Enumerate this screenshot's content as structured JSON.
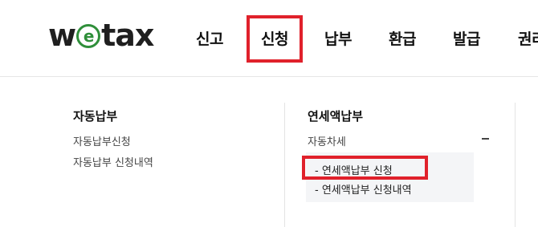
{
  "logo": {
    "part1": "w",
    "part_e": "e",
    "part2": "tax"
  },
  "nav": [
    {
      "label": "신고"
    },
    {
      "label": "신청"
    },
    {
      "label": "납부"
    },
    {
      "label": "환급"
    },
    {
      "label": "발급"
    },
    {
      "label": "권리"
    }
  ],
  "menu": {
    "col1": {
      "title": "자동납부",
      "links": [
        "자동납부신청",
        "자동납부 신청내역"
      ]
    },
    "col2": {
      "title": "연세액납부",
      "group_label": "자동차세",
      "group_icon": "minus-icon",
      "sub_links": [
        "- 연세액납부 신청",
        "- 연세액납부 신청내역"
      ]
    }
  },
  "colors": {
    "highlight": "#e0212b",
    "logo_green": "#2f8f3a"
  }
}
